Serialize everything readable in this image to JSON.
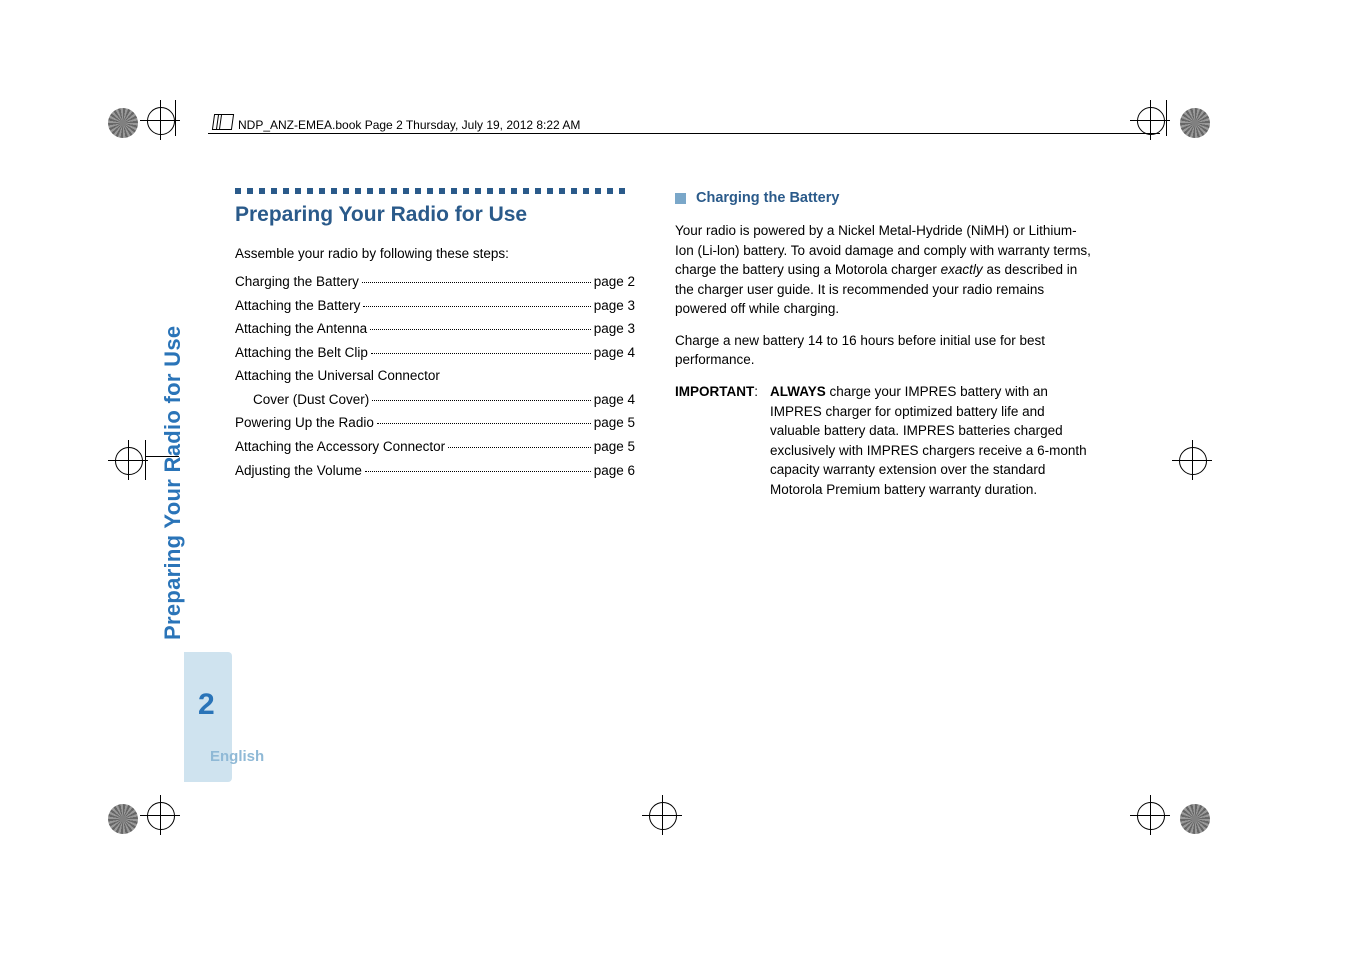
{
  "book_header": "NDP_ANZ-EMEA.book  Page 2  Thursday, July 19, 2012  8:22 AM",
  "section_title": "Preparing Your Radio for Use",
  "intro": "Assemble your radio by following these steps:",
  "toc": [
    {
      "label": "Charging the Battery",
      "page": "page 2"
    },
    {
      "label": "Attaching the Battery",
      "page": "page 3"
    },
    {
      "label": "Attaching the Antenna",
      "page": "page 3"
    },
    {
      "label": "Attaching the Belt Clip",
      "page": "page 4"
    },
    {
      "label": "Attaching the Universal Connector"
    },
    {
      "label": "Cover (Dust Cover)",
      "page": "page 4",
      "sub": true
    },
    {
      "label": "Powering Up the Radio",
      "page": "page 5"
    },
    {
      "label": "Attaching the Accessory Connector",
      "page": "page 5"
    },
    {
      "label": "Adjusting the Volume",
      "page": "page 6"
    }
  ],
  "right": {
    "subheading": "Charging the Battery",
    "p1a": "Your radio is powered by a Nickel Metal-Hydride (NiMH) or Lithium-Ion (Li-lon) battery. To avoid damage and comply with warranty terms, charge the battery using a Motorola charger ",
    "p1_italic": "exactly",
    "p1b": " as described in the charger user guide. It is recommended your radio remains powered off while charging.",
    "p2": "Charge a new battery 14 to 16 hours before initial use for best performance.",
    "important_label": "IMPORTANT",
    "important_colon": ":",
    "important_bold": "ALWAYS",
    "important_rest": " charge your IMPRES battery with an IMPRES charger for optimized battery life and valuable battery data. IMPRES batteries charged exclusively with IMPRES chargers receive a 6-month capacity warranty extension over the standard Motorola Premium battery warranty duration."
  },
  "side_title": "Preparing Your Radio for Use",
  "page_number": "2",
  "language": "English"
}
